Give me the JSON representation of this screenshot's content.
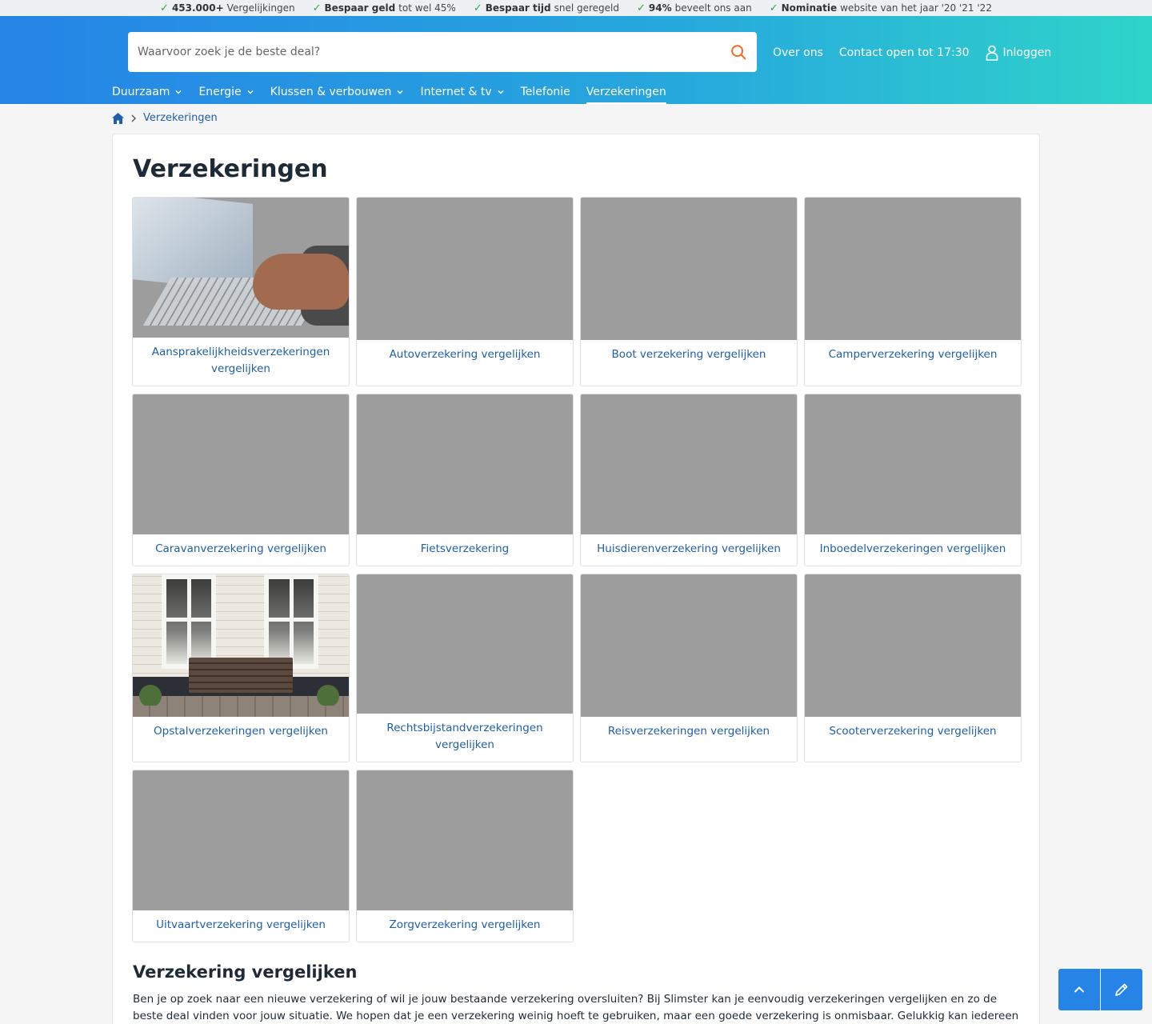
{
  "usps": [
    {
      "bold": "453.000+",
      "text": "Vergelijkingen"
    },
    {
      "bold": "Bespaar geld",
      "text": "tot wel 45%"
    },
    {
      "bold": "Bespaar tijd",
      "text": "snel geregeld"
    },
    {
      "bold": "94%",
      "text": "beveelt ons aan"
    },
    {
      "bold": "Nominatie",
      "text": "website van het jaar '20 '21 '22"
    }
  ],
  "search": {
    "placeholder": "Waarvoor zoek je de beste deal?"
  },
  "header_links": {
    "about": "Over ons",
    "contact": "Contact open tot 17:30",
    "login": "Inloggen"
  },
  "nav": [
    {
      "label": "Duurzaam",
      "dropdown": true
    },
    {
      "label": "Energie",
      "dropdown": true
    },
    {
      "label": "Klussen & verbouwen",
      "dropdown": true
    },
    {
      "label": "Internet & tv",
      "dropdown": true
    },
    {
      "label": "Telefonie",
      "dropdown": false
    },
    {
      "label": "Verzekeringen",
      "dropdown": false,
      "active": true
    }
  ],
  "breadcrumb": {
    "current": "Verzekeringen"
  },
  "page_title": "Verzekeringen",
  "cards": [
    {
      "title": "Aansprakelijkheidsverzekeringen vergelijken",
      "image": "laptop"
    },
    {
      "title": "Autoverzekering vergelijken",
      "image": "placeholder"
    },
    {
      "title": "Boot verzekering vergelijken",
      "image": "placeholder"
    },
    {
      "title": "Camperverzekering vergelijken",
      "image": "placeholder"
    },
    {
      "title": "Caravanverzekering vergelijken",
      "image": "placeholder"
    },
    {
      "title": "Fietsverzekering",
      "image": "placeholder"
    },
    {
      "title": "Huisdierenverzekering vergelijken",
      "image": "placeholder"
    },
    {
      "title": "Inboedelverzekeringen vergelijken",
      "image": "placeholder"
    },
    {
      "title": "Opstalverzekeringen vergelijken",
      "image": "house"
    },
    {
      "title": "Rechtsbijstandverzekeringen vergelijken",
      "image": "placeholder"
    },
    {
      "title": "Reisverzekeringen vergelijken",
      "image": "placeholder"
    },
    {
      "title": "Scooterverzekering vergelijken",
      "image": "placeholder"
    },
    {
      "title": "Uitvaartverzekering vergelijken",
      "image": "placeholder"
    },
    {
      "title": "Zorgverzekering vergelijken",
      "image": "placeholder"
    }
  ],
  "section": {
    "title": "Verzekering vergelijken",
    "text": "Ben je op zoek naar een nieuwe verzekering of wil je jouw bestaande verzekering oversluiten? Bij Slimster kan je eenvoudig verzekeringen vergelijken en zo de beste deal vinden voor jouw situatie. We hopen dat je een verzekering weinig hoeft te gebruiken, maar een goede verzekering is onmisbaar. Gelukkig kan iedereen zelf verzekeringen"
  },
  "colors": {
    "brand_blue": "#2584e6",
    "brand_teal": "#2fd4c9",
    "link": "#1f5fa8",
    "check_green": "#2fa64a",
    "search_icon": "#f26b21"
  }
}
